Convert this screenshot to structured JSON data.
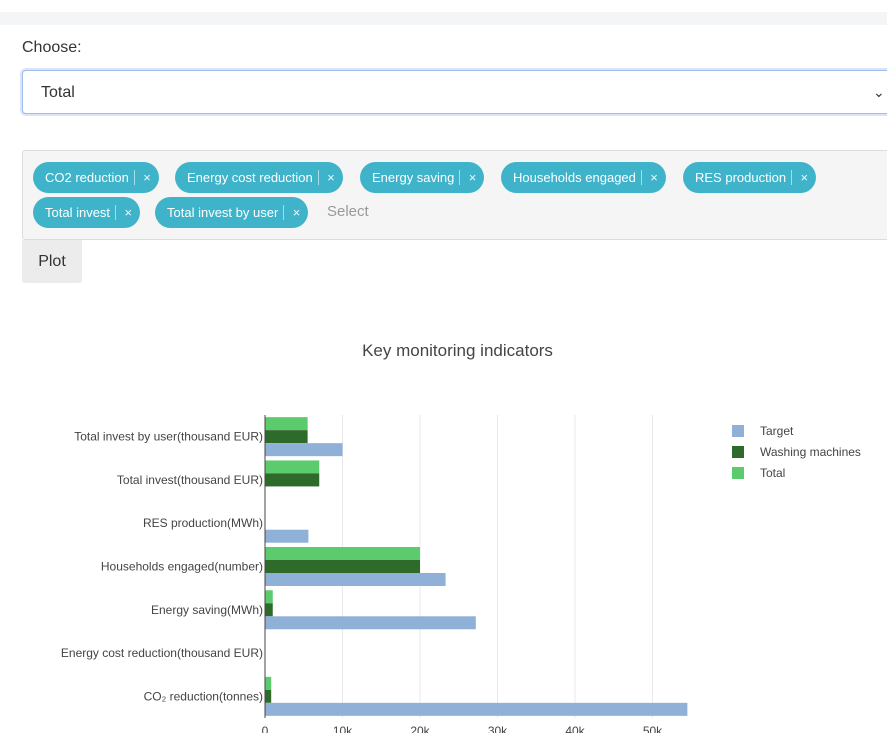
{
  "form": {
    "choose_label": "Choose:",
    "selected": "Total",
    "tags": [
      "CO2 reduction",
      "Energy cost reduction",
      "Energy saving",
      "Households engaged",
      "RES production",
      "Total invest",
      "Total invest by user"
    ],
    "tag_remove_symbol": "×",
    "tag_placeholder": "Select",
    "plot_label": "Plot"
  },
  "chart_data": {
    "type": "bar",
    "orientation": "horizontal",
    "title": "Key monitoring indicators",
    "categories": [
      "CO₂ reduction(tonnes)",
      "Energy cost reduction(thousand EUR)",
      "Energy saving(MWh)",
      "Households engaged(number)",
      "RES production(MWh)",
      "Total invest(thousand EUR)",
      "Total invest by user(thousand EUR)"
    ],
    "series": [
      {
        "name": "Target",
        "color": "#8fb1d8",
        "values": [
          54500,
          0,
          27200,
          23300,
          5600,
          0,
          10000
        ]
      },
      {
        "name": "Washing machines",
        "color": "#2e6b2a",
        "values": [
          800,
          0,
          1000,
          20000,
          0,
          7000,
          5500
        ]
      },
      {
        "name": "Total",
        "color": "#5ccb6d",
        "values": [
          800,
          0,
          1000,
          20000,
          0,
          7000,
          5500
        ]
      }
    ],
    "xlim": [
      0,
      55000
    ],
    "xticks": [
      0,
      10000,
      20000,
      30000,
      40000,
      50000
    ],
    "xtick_labels": [
      "0",
      "10k",
      "20k",
      "30k",
      "40k",
      "50k"
    ],
    "grid": true,
    "legend": "top-right"
  }
}
